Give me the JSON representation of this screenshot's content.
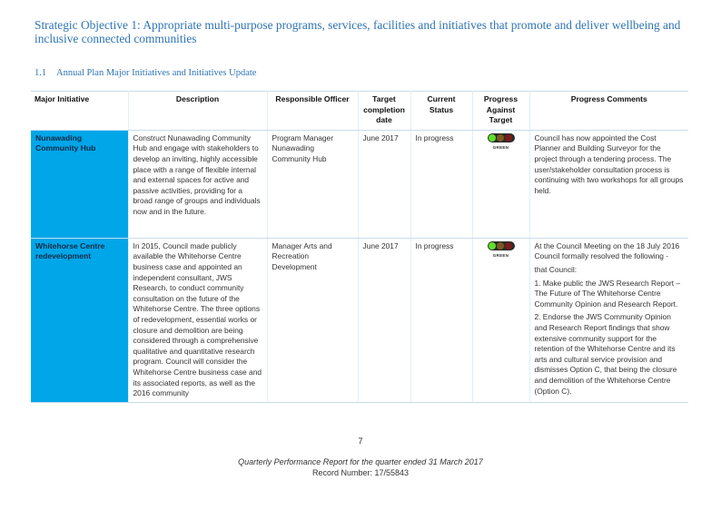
{
  "heading": "Strategic Objective 1: Appropriate multi-purpose programs, services, facilities and initiatives that promote and deliver wellbeing and inclusive connected communities",
  "subheading": {
    "number": "1.1",
    "title": "Annual Plan Major Initiatives and Initiatives Update"
  },
  "table": {
    "headers": [
      "Major Initiative",
      "Description",
      "Responsible Officer",
      "Target completion date",
      "Current Status",
      "Progress Against Target",
      "Progress Comments"
    ],
    "accent_color": "#00a6e8",
    "rows": [
      {
        "initiative": "Nunawading Community Hub",
        "description": "Construct Nunawading Community Hub and engage with stakeholders to develop an inviting, highly accessible place with a range of flexible internal and external spaces for active and passive activities, providing for a broad range of groups and individuals now and in the future.",
        "officer": "Program Manager Nunawading Community Hub",
        "target": "June 2017",
        "status": "In progress",
        "progress_icon": "traffic-light-green",
        "progress_label": "GREEN",
        "comments": [
          "Council has now appointed the Cost Planner and Building Surveyor for the project through a tendering process. The user/stakeholder consultation process is continuing with two workshops for all groups held."
        ]
      },
      {
        "initiative": "Whitehorse Centre redevelopment",
        "description": "In 2015, Council made publicly available the Whitehorse Centre business case and appointed an independent consultant, JWS Research, to conduct community consultation on the future of the Whitehorse Centre. The three options of redevelopment, essential works or closure and demolition are being considered through a comprehensive qualitative and quantitative research program. Council will consider the Whitehorse Centre business case and its associated reports, as well as the 2016 community",
        "officer": "Manager Arts and Recreation Development",
        "target": "June 2017",
        "status": "In progress",
        "progress_icon": "traffic-light-green",
        "progress_label": "GREEN",
        "comments": [
          "At the Council Meeting on the 18 July 2016 Council formally resolved the following -",
          "that Council:",
          "1. Make public the JWS Research Report – The Future of The Whitehorse Centre Community Opinion and Research Report.",
          "2. Endorse the JWS Community Opinion and Research Report findings that show extensive community support for the retention of the Whitehorse Centre and its arts and cultural service provision and dismisses Option C, that being the closure and demolition of the Whitehorse Centre (Option C)."
        ]
      }
    ]
  },
  "page_number": "7",
  "footer": {
    "title": "Quarterly Performance Report for the quarter ended 31 March 2017",
    "record": "Record Number: 17/55843"
  }
}
